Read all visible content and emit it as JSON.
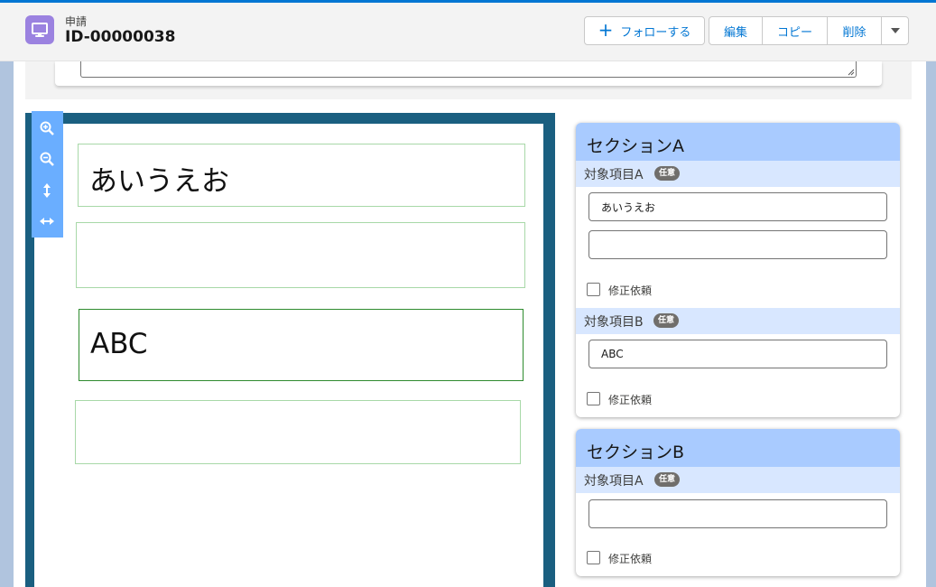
{
  "header": {
    "object_type": "申請",
    "record_name": "ID-00000038",
    "icon": "monitor-icon",
    "accent_color": "#0176d3",
    "icon_color": "#9b82e0"
  },
  "actions": {
    "follow_label": "フォローする",
    "edit_label": "編集",
    "copy_label": "コピー",
    "delete_label": "削除",
    "more_icon": "chevron-down-icon"
  },
  "viewer": {
    "tools": [
      "zoom-in-icon",
      "zoom-out-icon",
      "fit-height-icon",
      "fit-width-icon"
    ],
    "fields": [
      {
        "text": "あいうえお"
      },
      {
        "text": ""
      },
      {
        "text": "ABC"
      },
      {
        "text": ""
      }
    ]
  },
  "sections": [
    {
      "title": "セクションA",
      "fields": [
        {
          "label": "対象項目A",
          "badge": "任意",
          "values": [
            "あいうえお",
            ""
          ],
          "checkbox_label": "修正依頼"
        },
        {
          "label": "対象項目B",
          "badge": "任意",
          "values": [
            "ABC"
          ],
          "checkbox_label": "修正依頼"
        }
      ]
    },
    {
      "title": "セクションB",
      "fields": [
        {
          "label": "対象項目A",
          "badge": "任意",
          "values": [
            ""
          ],
          "checkbox_label": "修正依頼"
        }
      ]
    }
  ]
}
